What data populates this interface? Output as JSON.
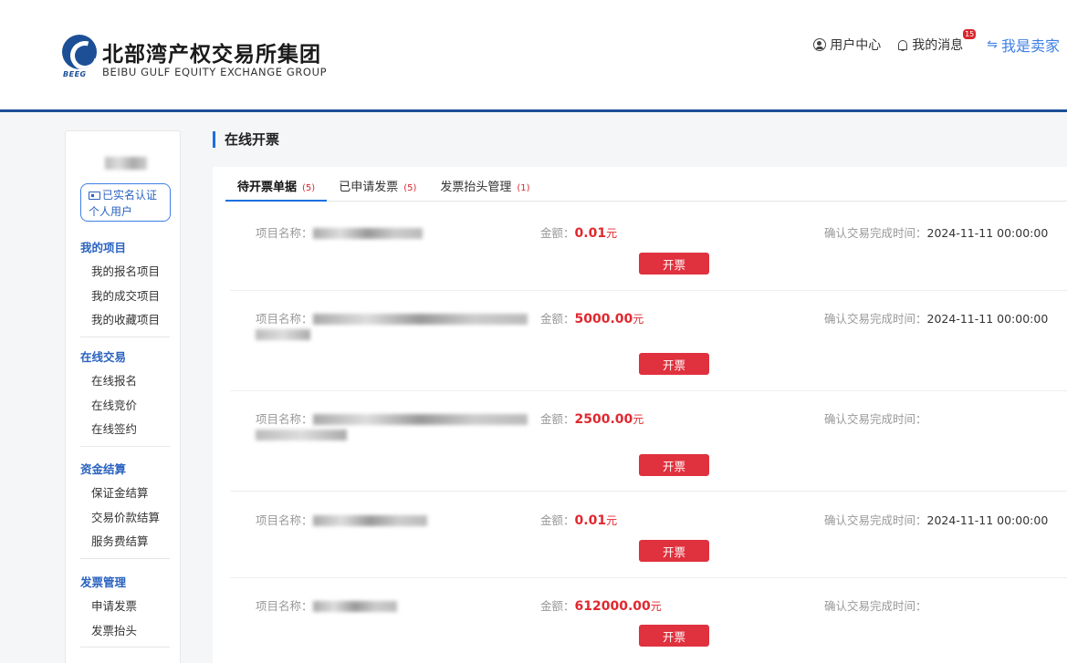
{
  "header": {
    "logo_cn": "北部湾产权交易所集团",
    "logo_en": "BEIBU GULF EQUITY EXCHANGE GROUP",
    "logo_abbr": "BEEG",
    "nav": {
      "user_center": "用户中心",
      "messages": "我的消息",
      "message_count": "15",
      "seller": "我是卖家"
    }
  },
  "sidebar": {
    "verify_line1": "已实名认证",
    "verify_line2": "个人用户",
    "groups": [
      {
        "title": "我的项目",
        "items": [
          "我的报名项目",
          "我的成交项目",
          "我的收藏项目"
        ]
      },
      {
        "title": "在线交易",
        "items": [
          "在线报名",
          "在线竞价",
          "在线签约"
        ]
      },
      {
        "title": "资金结算",
        "items": [
          "保证金结算",
          "交易价款结算",
          "服务费结算"
        ]
      },
      {
        "title": "发票管理",
        "items": [
          "申请发票",
          "发票抬头"
        ]
      }
    ]
  },
  "main": {
    "title": "在线开票",
    "tabs": [
      {
        "label": "待开票单据",
        "count": "(5)"
      },
      {
        "label": "已申请发票",
        "count": "(5)"
      },
      {
        "label": "发票抬头管理",
        "count": "(1)"
      }
    ],
    "labels": {
      "name": "项目名称：",
      "amount": "金额：",
      "time": "确认交易完成时间：",
      "unit": "元",
      "button": "开票"
    },
    "records": [
      {
        "amount": "0.01",
        "time": "2024-11-11 00:00:00"
      },
      {
        "amount": "5000.00",
        "time": "2024-11-11 00:00:00"
      },
      {
        "amount": "2500.00",
        "time": ""
      },
      {
        "amount": "0.01",
        "time": "2024-11-11 00:00:00"
      },
      {
        "amount": "612000.00",
        "time": ""
      }
    ]
  },
  "colors": {
    "brand": "#1c4f96",
    "accent": "#1c6fe0",
    "danger": "#e0313e"
  }
}
